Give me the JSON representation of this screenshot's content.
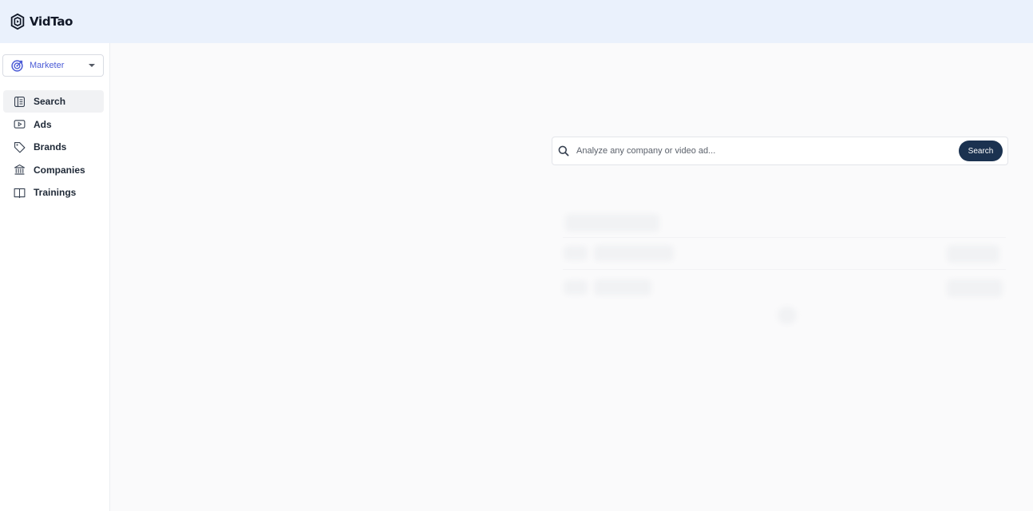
{
  "app": {
    "name": "VidTao",
    "brand_color": "#1b3250",
    "accent_color": "#4b5bd6"
  },
  "sidebar": {
    "role_selector": {
      "value": "Marketer",
      "icon": "target-icon"
    },
    "items": [
      {
        "label": "Search",
        "icon": "search-panel-icon",
        "active": true
      },
      {
        "label": "Ads",
        "icon": "play-icon",
        "active": false
      },
      {
        "label": "Brands",
        "icon": "tag-icon",
        "active": false
      },
      {
        "label": "Companies",
        "icon": "bank-icon",
        "active": false
      },
      {
        "label": "Trainings",
        "icon": "book-icon",
        "active": false
      }
    ]
  },
  "search": {
    "placeholder": "Analyze any company or video ad...",
    "value": "",
    "button_label": "Search"
  }
}
